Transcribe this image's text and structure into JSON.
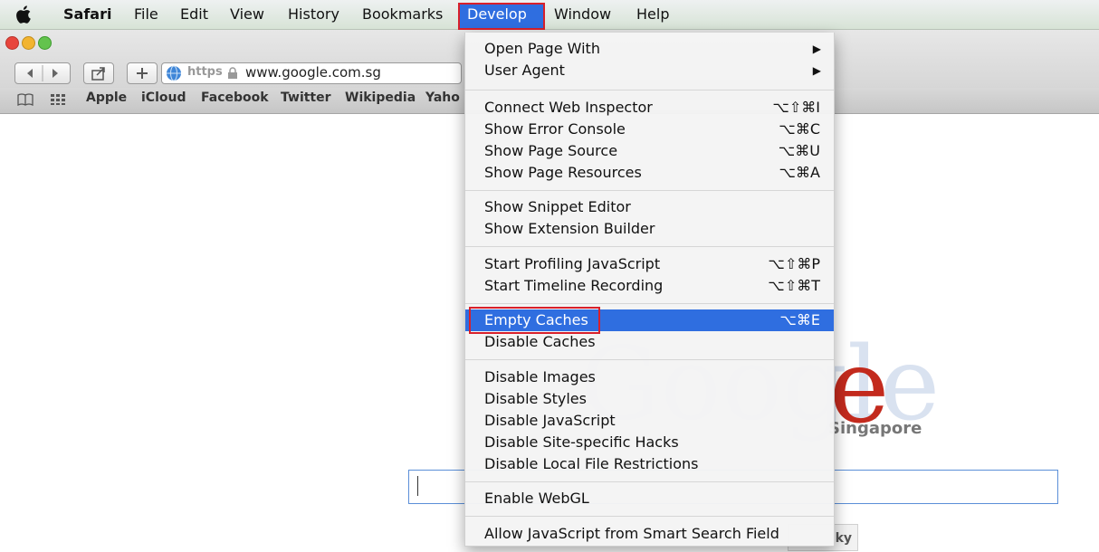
{
  "menubar": {
    "items": [
      "Safari",
      "File",
      "Edit",
      "View",
      "History",
      "Bookmarks",
      "Develop",
      "Window",
      "Help"
    ]
  },
  "browser": {
    "address": "www.google.com.sg",
    "scheme": "https",
    "bookmarks": [
      "Apple",
      "iCloud",
      "Facebook",
      "Twitter",
      "Wikipedia",
      "Yaho"
    ]
  },
  "page": {
    "logo": "Google",
    "region": "Singapore",
    "lucky_button_fragment": "ky"
  },
  "develop_menu": {
    "items": [
      {
        "label": "Open Page With",
        "shortcut": "",
        "submenu": true
      },
      {
        "label": "User Agent",
        "shortcut": "",
        "submenu": true
      },
      {
        "label": "Connect Web Inspector",
        "shortcut": "⌥⇧⌘I"
      },
      {
        "label": "Show Error Console",
        "shortcut": "⌥⌘C"
      },
      {
        "label": "Show Page Source",
        "shortcut": "⌥⌘U"
      },
      {
        "label": "Show Page Resources",
        "shortcut": "⌥⌘A"
      },
      {
        "label": "Show Snippet Editor",
        "shortcut": ""
      },
      {
        "label": "Show Extension Builder",
        "shortcut": ""
      },
      {
        "label": "Start Profiling JavaScript",
        "shortcut": "⌥⇧⌘P"
      },
      {
        "label": "Start Timeline Recording",
        "shortcut": "⌥⇧⌘T"
      },
      {
        "label": "Empty Caches",
        "shortcut": "⌥⌘E",
        "selected": true
      },
      {
        "label": "Disable Caches",
        "shortcut": ""
      },
      {
        "label": "Disable Images",
        "shortcut": ""
      },
      {
        "label": "Disable Styles",
        "shortcut": ""
      },
      {
        "label": "Disable JavaScript",
        "shortcut": ""
      },
      {
        "label": "Disable Site-specific Hacks",
        "shortcut": ""
      },
      {
        "label": "Disable Local File Restrictions",
        "shortcut": ""
      },
      {
        "label": "Enable WebGL",
        "shortcut": ""
      },
      {
        "label": "Allow JavaScript from Smart Search Field",
        "shortcut": ""
      }
    ]
  },
  "colors": {
    "selection": "#2f6ee0",
    "highlight_border": "#d8202b"
  }
}
